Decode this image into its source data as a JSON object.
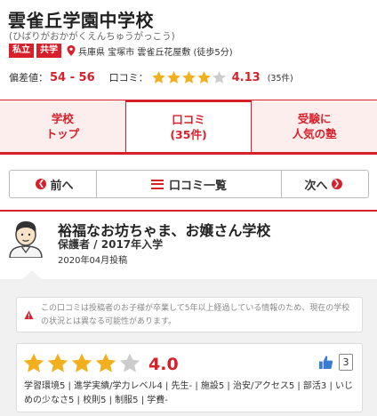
{
  "school": {
    "name": "雲雀丘学園中学校",
    "kana": "(ひばりがおかがくえんちゅうがっこう)",
    "tags": [
      "私立",
      "共学"
    ],
    "address": "兵庫県 宝塚市 雲雀丘花屋敷 (徒歩5分)"
  },
  "stats": {
    "hensachi_label": "偏差値：",
    "hensachi_value": "54 - 56",
    "kuchikomi_label": "口コミ：",
    "rating": "4.13",
    "rating_stars": 4.13,
    "count": "(35件)"
  },
  "tabs": [
    {
      "label_line1": "学校",
      "label_line2": "トップ"
    },
    {
      "label_line1": "口コミ",
      "label_line2": "(35件)"
    },
    {
      "label_line1": "受験に",
      "label_line2": "人気の塾"
    }
  ],
  "pager": {
    "prev": "前へ",
    "list": "口コミ一覧",
    "next": "次へ"
  },
  "review": {
    "title": "裕福なお坊ちゃま、お嬢さん学校",
    "reviewer": "保護者 / 2017年入学",
    "posted": "2020年04月投稿",
    "notice": "この口コミは投稿者のお子様が卒業して5年以上経過している情報のため、現在の学校の状況とは異なる可能性があります。",
    "rating": "4.0",
    "rating_stars": 4.0,
    "likes": "3",
    "scores": "学習環境5 | 進学実績/学力レベル4 | 先生- | 施設5 | 治安/アクセス5 | 部活3 | いじめの少なさ5 | 校則5 | 制服5 | 学費-"
  },
  "colors": {
    "accent": "#d8202a",
    "star": "#f2b01e",
    "star_empty": "#cccccc",
    "like": "#3a7bd5"
  },
  "icons": {
    "location": "location-pin-icon",
    "menu": "list-icon",
    "warning": "warning-icon",
    "like": "thumbs-up-icon",
    "avatar": "parent-avatar-icon"
  }
}
